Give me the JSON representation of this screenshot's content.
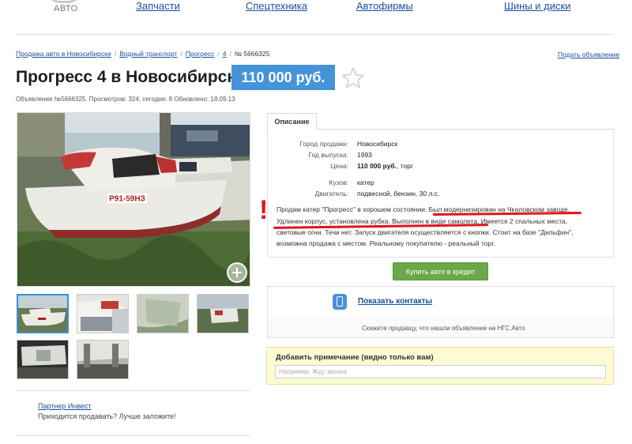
{
  "header": {
    "logo_text": "АВТО",
    "nav": [
      "Запчасти",
      "Спецтехника",
      "Автофирмы",
      "Шины и диски"
    ]
  },
  "breadcrumbs": [
    "Продажа авто в Новосибирске",
    "Водный транспорт",
    "Прогресс",
    "4"
  ],
  "breadcrumb_current": "№ 5666325",
  "post_ad_link": "Подать объявление",
  "listing": {
    "title": "Прогресс 4 в Новосибирске",
    "price": "110 000 руб.",
    "meta": "Объявление №5666325.  Просмотров: 324; сегодня: 8  Обновлено: 18.09.13"
  },
  "description": {
    "tab": "Описание",
    "props": [
      {
        "label": "Город продажи:",
        "value": "Новосибирск"
      },
      {
        "label": "Год выпуска:",
        "value": "1993"
      },
      {
        "label": "Цена:",
        "value_bold": "110 000 руб.",
        "value_suffix": ", торг"
      },
      {
        "label": "Кузов:",
        "value": "катер"
      },
      {
        "label": "Двигатель:",
        "value": "подвесной, бензин, 30 л.с."
      }
    ],
    "text_lines": [
      "Продам катер \"Прогресс\" в хорошем состоянии. Был модернизирован на Чкаловском заводе.",
      "Удлинен корпус, установлена рубка. Выполнен в виде самолета. Имеется 2 спальных места,",
      "световые огни. Течи нет. Запуск двигателя осуществляется с кнопки. Стоит на базе \"Дельфин\",",
      "возможна продажа с местом. Реальному покупателю - реальный торг."
    ],
    "annotation_mark": "!"
  },
  "photo": {
    "plate": "Р91-59НЗ"
  },
  "credit_button": "Купить авто в кредит",
  "contacts": {
    "button": "Показать контакты",
    "hint": "Скажите продавцу, что нашли объявление на НГС.Авто"
  },
  "note": {
    "title": "Добавить примечание (видно только вам)",
    "placeholder": "Например: Жду звонка"
  },
  "partner": {
    "link": "Партнер Инвест",
    "note": "Приходится продавать? Лучше заложите!"
  },
  "colors": {
    "link": "#1a4f9c",
    "price_badge": "#4594d8",
    "credit_button": "#6aa84a",
    "annotation": "#e0151f",
    "note_bg": "#fdfbd4"
  },
  "icons": [
    "star-icon",
    "zoom-icon",
    "phone-icon"
  ]
}
